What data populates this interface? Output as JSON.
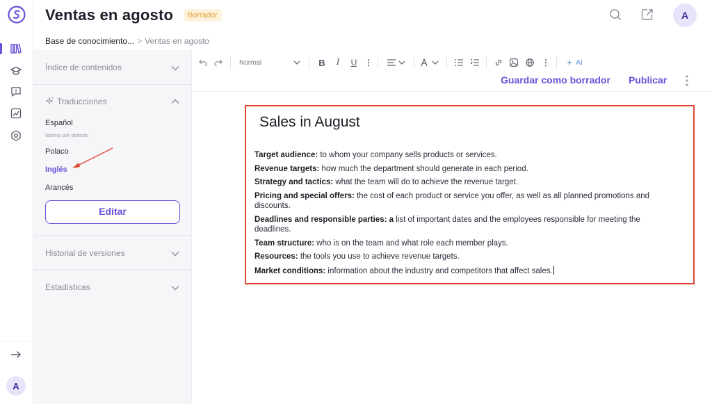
{
  "app": {
    "title": "Ventas en agosto",
    "status_badge": "Borrador",
    "avatar_initial": "A"
  },
  "breadcrumb": {
    "parent": "Base de conocimiento...",
    "separator": ">",
    "current": "Ventas en agosto"
  },
  "rail": {
    "icons": [
      "knowledge-base-icon",
      "learning-icon",
      "help-icon",
      "analytics-icon",
      "settings-icon"
    ],
    "bottom_avatar": "A"
  },
  "header_icons": [
    "search-icon",
    "share-icon"
  ],
  "sidebar": {
    "toc_label": "Índice de contenidos",
    "translations_label": "Traducciones",
    "languages": [
      {
        "name": "Español",
        "sub": "Idioma por defecto",
        "active": false
      },
      {
        "name": "Polaco",
        "sub": "",
        "active": false
      },
      {
        "name": "Inglés",
        "sub": "",
        "active": true
      },
      {
        "name": "Arancés",
        "sub": "",
        "active": false
      }
    ],
    "edit_button": "Editar",
    "history_label": "Historial de versiones",
    "stats_label": "Estadísticas"
  },
  "toolbar": {
    "style_select": "Normal",
    "ai_label": "AI",
    "save_draft": "Guardar como borrador",
    "publish": "Publicar"
  },
  "document": {
    "title": "Sales in August",
    "items": [
      {
        "bold": "Target audience:",
        "text": " to whom your company sells products or services."
      },
      {
        "bold": "Revenue targets:",
        "text": " how much the department should generate in each period."
      },
      {
        "bold": "Strategy and tactics:",
        "text": " what the team will do to achieve the revenue target."
      },
      {
        "bold": "Pricing and special offers:",
        "text": " the cost of each product or service you offer, as well as all planned promotions and discounts."
      },
      {
        "bold": "Deadlines and responsible parties: a",
        "text": " list of important dates and the employees responsible for meeting the deadlines."
      },
      {
        "bold": "Team structure:",
        "text": " who is on the team and what role each member plays."
      },
      {
        "bold": "Resources:",
        "text": " the tools you use to achieve revenue targets."
      },
      {
        "bold": "Market conditions:",
        "text": " information about the industry and competitors that affect sales."
      }
    ]
  },
  "colors": {
    "accent": "#6c4fd8",
    "annotation": "#e0452f",
    "badge_bg": "#fdf2dc",
    "badge_text": "#e3a43a"
  }
}
